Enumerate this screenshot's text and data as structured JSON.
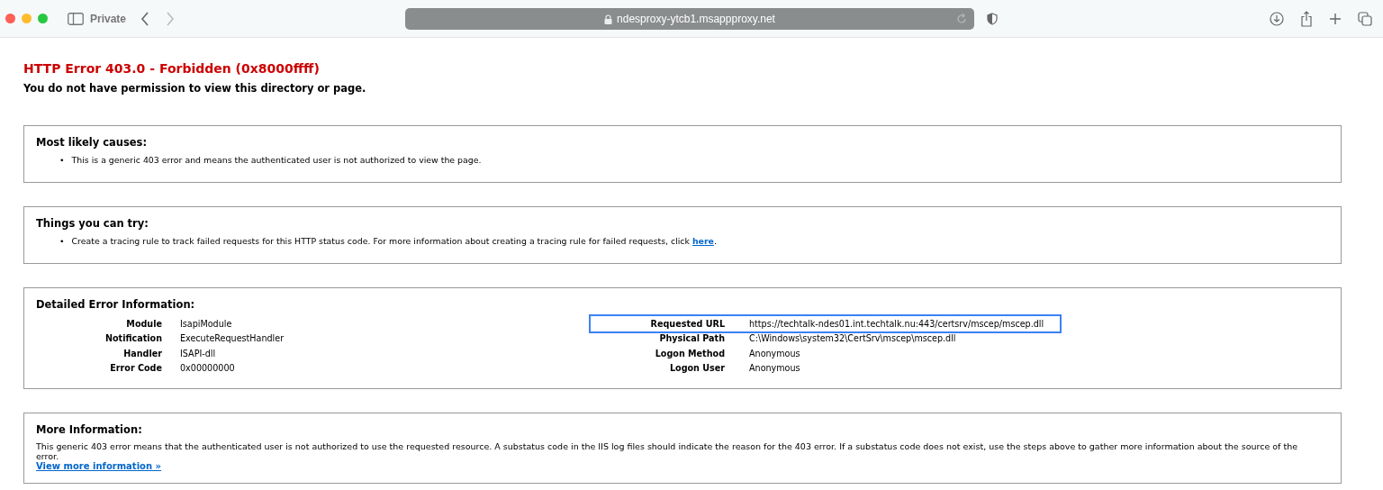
{
  "browser": {
    "mode_label": "Private",
    "address": "ndesproxy-ytcb1.msappproxy.net"
  },
  "error": {
    "title": "HTTP Error 403.0 - Forbidden (0x8000ffff)",
    "subtitle": "You do not have permission to view this directory or page."
  },
  "causes": {
    "heading": "Most likely causes:",
    "bullet": "•",
    "items": [
      "This is a generic 403 error and means the authenticated user is not authorized to view the page."
    ]
  },
  "try": {
    "heading": "Things you can try:",
    "bullet": "•",
    "text": "Create a tracing rule to track failed requests for this HTTP status code. For more information about creating a tracing rule for failed requests, click ",
    "link": "here",
    "suffix": "."
  },
  "details": {
    "heading": "Detailed Error Information:",
    "left": [
      {
        "label": "Module",
        "value": "IsapiModule",
        "highlighted": false
      },
      {
        "label": "Notification",
        "value": "ExecuteRequestHandler",
        "highlighted": false
      },
      {
        "label": "Handler",
        "value": "ISAPI-dll",
        "highlighted": false
      },
      {
        "label": "Error Code",
        "value": "0x00000000",
        "highlighted": false
      }
    ],
    "right": [
      {
        "label": "Requested URL",
        "value": "https://techtalk-ndes01.int.techtalk.nu:443/certsrv/mscep/mscep.dll",
        "highlighted": true
      },
      {
        "label": "Physical Path",
        "value": "C:\\Windows\\system32\\CertSrv\\mscep\\mscep.dll",
        "highlighted": false
      },
      {
        "label": "Logon Method",
        "value": "Anonymous",
        "highlighted": false
      },
      {
        "label": "Logon User",
        "value": "Anonymous",
        "highlighted": false
      }
    ]
  },
  "more": {
    "heading": "More Information:",
    "text": "This generic 403 error means that the authenticated user is not authorized to use the requested resource. A substatus code in the IIS log files should indicate the reason for the 403 error. If a substatus code does not exist, use the steps above to gather more information about the source of the error.",
    "link": "View more information »"
  }
}
